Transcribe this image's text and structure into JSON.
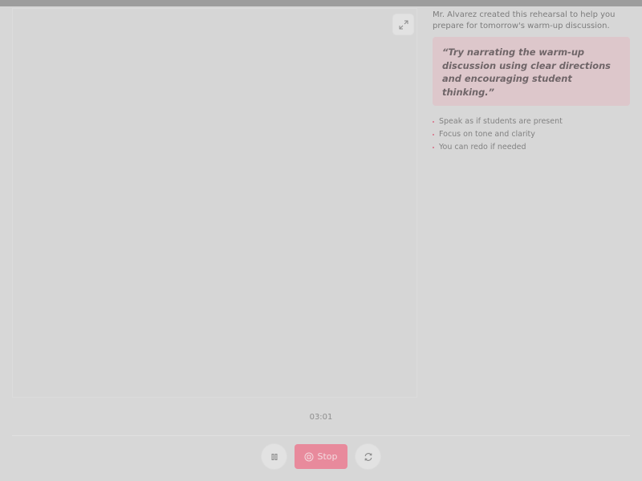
{
  "rehearsal": {
    "intro": "Mr. Alvarez created this rehearsal to help you prepare for tomorrow's warm-up discussion.",
    "quote": "“Try narrating the warm-up discussion using clear directions and encouraging student thinking.”",
    "tips": [
      "Speak as if students are present",
      "Focus on tone and clarity",
      "You can redo if needed"
    ]
  },
  "recorder": {
    "timer": "03:01",
    "stop_label": "Stop"
  },
  "colors": {
    "accent": "#e88a9c",
    "quote_bg": "#ddc7cb",
    "bullet": "#d96c86"
  },
  "icons": {
    "expand": "expand-icon",
    "pause": "pause-icon",
    "stop": "stop-circle-icon",
    "restart": "restart-icon"
  }
}
